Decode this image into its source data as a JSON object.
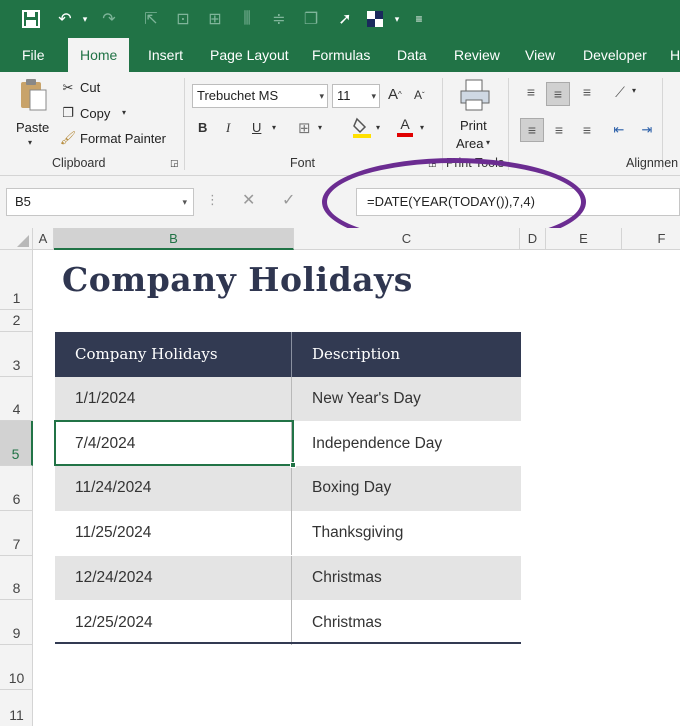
{
  "ribbon_tabs": [
    "File",
    "Home",
    "Insert",
    "Page Layout",
    "Formulas",
    "Data",
    "Review",
    "View",
    "Developer",
    "H"
  ],
  "clipboard": {
    "paste": "Paste",
    "cut": "Cut",
    "copy": "Copy",
    "format_painter": "Format Painter",
    "label": "Clipboard"
  },
  "font": {
    "family": "Trebuchet MS",
    "size": "11",
    "label": "Font",
    "bold": "B",
    "italic": "I",
    "underline": "U"
  },
  "print": {
    "line1": "Print",
    "line2": "Area",
    "label": "Print Tools"
  },
  "alignment": {
    "label": "Alignmen"
  },
  "formula_bar": {
    "name_box": "B5",
    "formula": "=DATE(YEAR(TODAY()),7,4)"
  },
  "columns": [
    "A",
    "B",
    "C",
    "D",
    "E",
    "F"
  ],
  "rows": [
    "1",
    "2",
    "3",
    "4",
    "5",
    "6",
    "7",
    "8",
    "9",
    "10",
    "11"
  ],
  "sheet": {
    "title": "Company Holidays",
    "table_headers": [
      "Company Holidays",
      "Description"
    ],
    "holidays": [
      {
        "date": "1/1/2024",
        "description": "New Year's Day"
      },
      {
        "date": "7/4/2024",
        "description": "Independence Day"
      },
      {
        "date": "11/24/2024",
        "description": "Boxing Day"
      },
      {
        "date": "11/25/2024",
        "description": "Thanksgiving"
      },
      {
        "date": "12/24/2024",
        "description": "Christmas"
      },
      {
        "date": "12/25/2024",
        "description": "Christmas"
      }
    ]
  },
  "colors": {
    "excel_green": "#217346",
    "header_navy": "#323a52",
    "highlight_oval": "#6b2c91"
  }
}
